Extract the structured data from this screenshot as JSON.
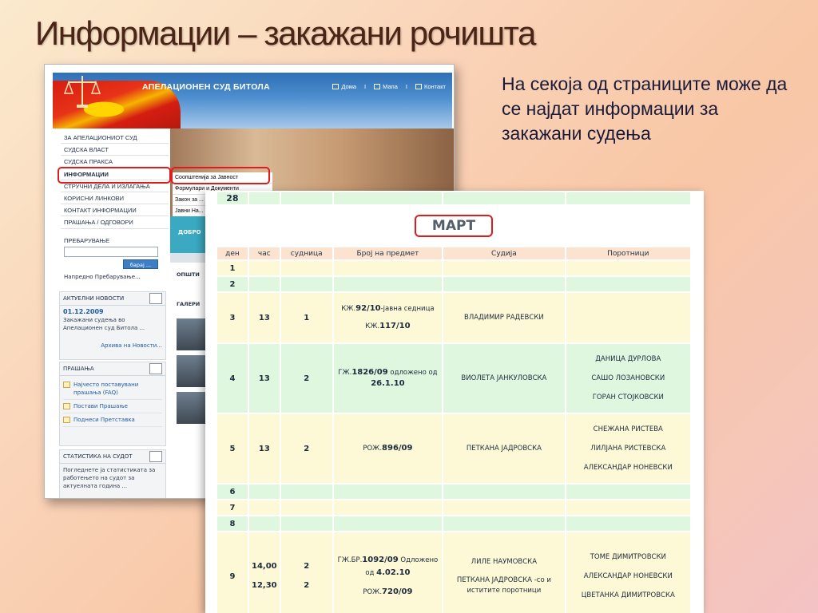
{
  "slide": {
    "title": "Информации – закажани рочишта",
    "note": "На секоја од страниците може да се најдат информации за закажани судења"
  },
  "site": {
    "name": "АПЕЛАЦИОНЕН СУД БИТОЛА",
    "top_links": [
      "Дома",
      "Мапа",
      "Контакт"
    ],
    "menu": [
      "ЗА АПЕЛАЦИОНИОТ СУД",
      "СУДСКА ВЛАСТ",
      "СУДСКА ПРАКСА",
      "ИНФОРМАЦИИ",
      "СТРУЧНИ ДЕЛА И ИЗЛАГАЊА",
      "КОРИСНИ ЛИНКОВИ",
      "КОНТАКТ ИНФОРМАЦИИ",
      "ПРАШАЊА / ОДГОВОРИ"
    ],
    "submenu": [
      "Соопштенија за Јавност",
      "Формулари и Документи",
      "Закон за ...",
      "Јавни На..."
    ],
    "search_label": "ПРЕБАРУВАЊЕ",
    "search_button": "барај ...",
    "advanced_search": "Напредно Пребарување...",
    "news": {
      "title": "АКТУЕЛНИ НОВОСТИ",
      "date": "01.12.2009",
      "text": "Закажани судења во Апелационен суд Битола ...",
      "archive": "Архива на Новости..."
    },
    "questions": {
      "title": "ПРАШАЊА",
      "items": [
        "Најчесто поставувани прашања (FAQ)",
        "Постави Прашање",
        "Поднеси Претставка"
      ]
    },
    "stats": {
      "title": "СТАТИСТИКА НА СУДОТ",
      "text": "Погледнете ја статистиката за работењето на судот за актуелната година ..."
    },
    "side_labels": [
      "ДОБРО",
      "ОПШТИ",
      "ГАЛЕРИ"
    ]
  },
  "calendar": {
    "prev_day": "28",
    "month": "МАРТ",
    "headers": [
      "ден",
      "час",
      "судница",
      "Број на предмет",
      "Судија",
      "Поротници"
    ],
    "rows": [
      {
        "day": "1",
        "style": "y"
      },
      {
        "day": "2",
        "style": "g"
      },
      {
        "day": "3",
        "style": "y",
        "hour": "13",
        "room": "1",
        "case1": "КЖ.",
        "case1b": "92/10",
        "case1c": "-јавна седница",
        "case2": "КЖ.",
        "case2b": "117/10",
        "case2c": "",
        "judge": "ВЛАДИМИР РАДЕВСКИ",
        "jurors": []
      },
      {
        "day": "4",
        "style": "g",
        "hour": "13",
        "room": "2",
        "case1": "ГЖ.",
        "case1b": "1826/09",
        "case1c": " одложено од",
        "case2": "",
        "case2b": "26.1.10",
        "case2c": "",
        "judge": "ВИОЛЕТА ЈАНКУЛОВСКА",
        "jurors": [
          "ДАНИЦА ДУРЛОВА",
          "САШО ЛОЗАНОВСКИ",
          "ГОРАН СТОЈКОВСКИ"
        ]
      },
      {
        "day": "5",
        "style": "y",
        "hour": "13",
        "room": "2",
        "case1": "РОЖ.",
        "case1b": "896/09",
        "case1c": "",
        "case2": "",
        "case2b": "",
        "case2c": "",
        "judge": "ПЕТКАНА ЈАДРОВСКА",
        "jurors": [
          "СНЕЖАНА РИСТЕВА",
          "ЛИЛЈАНА РИСТЕВСКА",
          "АЛЕКСАНДАР НОНЕВСКИ"
        ]
      },
      {
        "day": "6",
        "style": "g"
      },
      {
        "day": "7",
        "style": "y"
      },
      {
        "day": "8",
        "style": "g"
      },
      {
        "day": "9",
        "style": "y",
        "hour": "14,00",
        "hour2": "12,30",
        "room": "2",
        "room2": "2",
        "case1": "ГЖ.БР.",
        "case1b": "1092/09",
        "case1c": " Одложено",
        "case1d": "од ",
        "case1e": "4.02.10",
        "case2": "РОЖ.",
        "case2b": "720/09",
        "case2c": "",
        "judge": "ЛИЛЕ НАУМОВСКА",
        "judge2": "ПЕТКАНА ЈАДРОВСКА -со и иститите поротници",
        "jurors": [
          "ТОМЕ ДИМИТРОВСКИ",
          "АЛЕКСАНДАР НОНЕВСКИ",
          "ЦВЕТАНКА ДИМИТРОВСКА"
        ]
      }
    ]
  },
  "colors": {
    "highlight": "#e01b1b",
    "row_yellow": "#fdf9d6",
    "row_green": "#dff6df",
    "header_peach": "#fbe3d0"
  }
}
